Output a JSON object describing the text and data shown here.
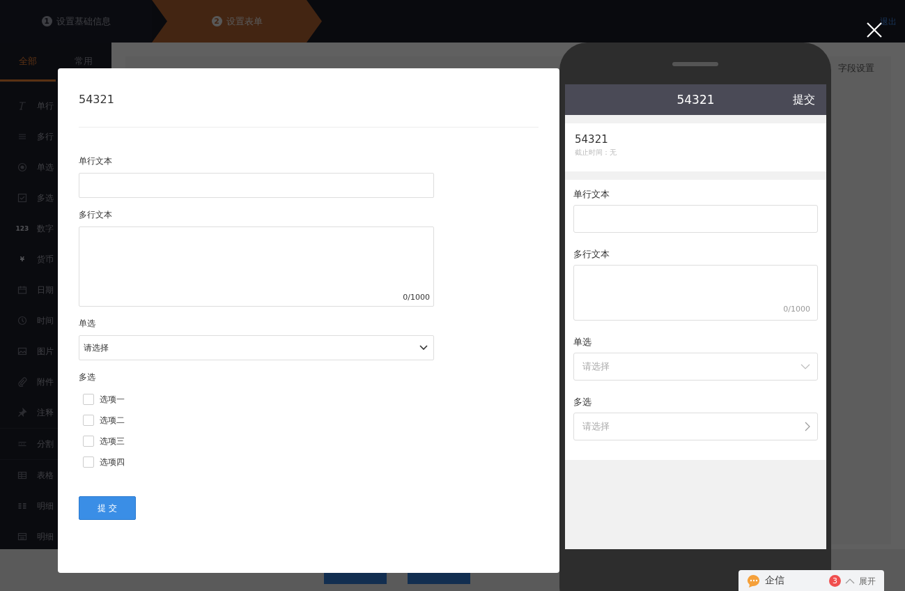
{
  "steps": [
    {
      "number": "1",
      "label": "设置基础信息",
      "selected": false
    },
    {
      "number": "2",
      "label": "设置表单",
      "selected": true
    }
  ],
  "exit_link": "退出",
  "sidebar": {
    "tabs": [
      {
        "label": "全部",
        "selected": true
      },
      {
        "label": "常用",
        "selected": false
      }
    ],
    "items": [
      {
        "kind": "text",
        "label": "单行"
      },
      {
        "kind": "lines",
        "label": "多行"
      },
      {
        "kind": "radio",
        "label": "单选"
      },
      {
        "kind": "checkbox",
        "label": "多选"
      },
      {
        "kind": "glyph",
        "glyph": "123",
        "label": "数字"
      },
      {
        "kind": "glyph",
        "glyph": "¥",
        "label": "货币"
      },
      {
        "kind": "calendar",
        "label": "日期"
      },
      {
        "kind": "clock",
        "label": "时间"
      },
      {
        "kind": "image",
        "label": "图片"
      },
      {
        "kind": "clip",
        "label": "附件"
      },
      {
        "kind": "pin",
        "label": "注释"
      },
      {
        "kind": "divider",
        "label": "分割"
      },
      {
        "kind": "table",
        "label": "表格"
      },
      {
        "kind": "grid",
        "label": "明细"
      },
      {
        "kind": "detail",
        "label": "明细"
      }
    ]
  },
  "panel_tab": "字段设置",
  "footer_buttons": [
    {
      "kind": "primary"
    },
    {
      "kind": "primary"
    }
  ],
  "preview": {
    "title": "54321",
    "fields": [
      {
        "kind": "text",
        "label": "单行文本"
      },
      {
        "kind": "textarea",
        "label": "多行文本",
        "counter": "0/1000"
      },
      {
        "kind": "select",
        "label": "单选",
        "placeholder": "请选择"
      },
      {
        "kind": "checkboxes",
        "label": "多选",
        "options": [
          {
            "label": "选项一",
            "checked": false
          },
          {
            "label": "选项二",
            "checked": false
          },
          {
            "label": "选项三",
            "checked": false
          },
          {
            "label": "选项四",
            "checked": false
          }
        ]
      }
    ],
    "submit": "提 交"
  },
  "phone": {
    "header_title": "54321",
    "header_action": "提交",
    "form_title": "54321",
    "deadline": "截止时间：无",
    "fields": [
      {
        "kind": "text",
        "label": "单行文本"
      },
      {
        "kind": "textarea",
        "label": "多行文本",
        "counter": "0/1000"
      },
      {
        "kind": "select",
        "label": "单选",
        "placeholder": "请选择"
      },
      {
        "kind": "picker",
        "label": "多选",
        "placeholder": "请选择"
      }
    ]
  },
  "chat_widget": {
    "label": "企信",
    "badge": "3",
    "action": "展开"
  }
}
